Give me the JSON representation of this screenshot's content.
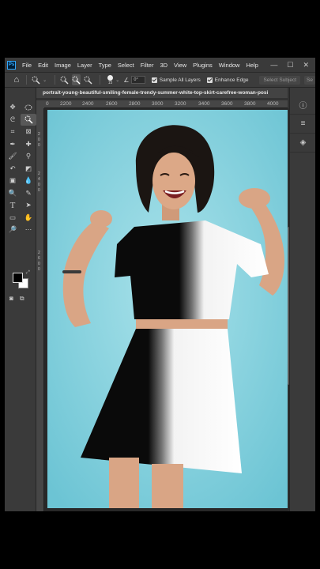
{
  "app": {
    "logo": "Ps",
    "menu": [
      "File",
      "Edit",
      "Image",
      "Layer",
      "Type",
      "Select",
      "Filter",
      "3D",
      "View",
      "Plugins",
      "Window",
      "Help"
    ],
    "window_controls": [
      "—",
      "☐",
      "✕"
    ]
  },
  "options_bar": {
    "brush_size": "15",
    "angle_value": "0°",
    "sample_all_layers": {
      "label": "Sample All Layers",
      "checked": true
    },
    "enhance_edge": {
      "label": "Enhance Edge",
      "checked": true
    },
    "select_subject_label": "Select Subject",
    "overflow_label": "Se"
  },
  "document": {
    "tab_title": "portrait-young-beautiful-smiling-female-trendy-summer-white-top-skirt-carefree-woman-posi"
  },
  "ruler": {
    "marks": [
      "0",
      "2200",
      "2400",
      "2600",
      "2800",
      "3000",
      "3200",
      "3400",
      "3600",
      "3800",
      "4000"
    ],
    "vertical_marks": [
      "2",
      "0",
      "0",
      "2",
      "4",
      "0",
      "0",
      "2",
      "6",
      "0",
      "0"
    ]
  },
  "toolbar": {
    "tools": [
      "move-icon",
      "marquee-icon",
      "lasso-icon",
      "quick-selection-icon",
      "crop-icon",
      "frame-icon",
      "eyedropper-icon",
      "healing-brush-icon",
      "brush-icon",
      "clone-stamp-icon",
      "history-brush-icon",
      "eraser-icon",
      "gradient-icon",
      "blur-icon",
      "dodge-icon",
      "pen-icon",
      "type-icon",
      "path-selection-icon",
      "rectangle-icon",
      "hand-icon",
      "zoom-icon",
      "more-tools-icon"
    ],
    "foreground_color": "#000000",
    "background_color": "#ffffff"
  },
  "panels": [
    "info-icon",
    "adjustments-icon",
    "layers-icon"
  ],
  "colors": {
    "app_bg": "#323232",
    "canvas_bg": "#8ed4e0",
    "accent": "#31a8ff"
  }
}
